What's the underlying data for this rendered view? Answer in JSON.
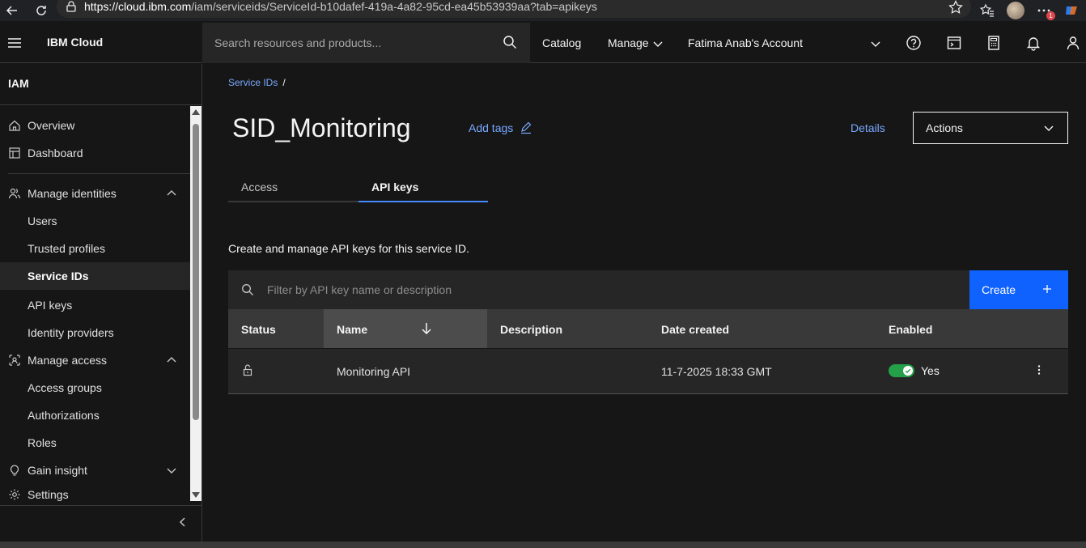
{
  "browser": {
    "url_domain": "https://cloud.ibm.com",
    "url_path": "/iam/serviceids/ServiceId-b10dafef-419a-4a82-95cd-ea45b53939aa?tab=apikeys",
    "notification_badge": "1"
  },
  "header": {
    "brand": "IBM Cloud",
    "search_placeholder": "Search resources and products...",
    "catalog": "Catalog",
    "manage": "Manage",
    "account": "Fatima Anab's Account"
  },
  "sidebar": {
    "title": "IAM",
    "items": {
      "overview": "Overview",
      "dashboard": "Dashboard",
      "manage_identities": "Manage identities",
      "users": "Users",
      "trusted_profiles": "Trusted profiles",
      "service_ids": "Service IDs",
      "api_keys": "API keys",
      "identity_providers": "Identity providers",
      "manage_access": "Manage access",
      "access_groups": "Access groups",
      "authorizations": "Authorizations",
      "roles": "Roles",
      "gain_insight": "Gain insight",
      "settings": "Settings"
    }
  },
  "main": {
    "breadcrumb": "Service IDs",
    "breadcrumb_sep": "/",
    "title": "SID_Monitoring",
    "add_tags": "Add tags",
    "details": "Details",
    "actions": "Actions",
    "tabs": {
      "access": "Access",
      "api_keys": "API keys"
    },
    "description": "Create and manage API keys for this service ID.",
    "filter_placeholder": "Filter by API key name or description",
    "create": "Create",
    "table": {
      "headers": {
        "status": "Status",
        "name": "Name",
        "description": "Description",
        "date_created": "Date created",
        "enabled": "Enabled"
      },
      "rows": [
        {
          "name": "Monitoring API",
          "description": "",
          "date_created": "11-7-2025 18:33 GMT",
          "enabled": "Yes"
        }
      ]
    }
  },
  "colors": {
    "accent_blue": "#0f62fe",
    "link_blue": "#78a9ff",
    "toggle_green": "#24a148"
  }
}
